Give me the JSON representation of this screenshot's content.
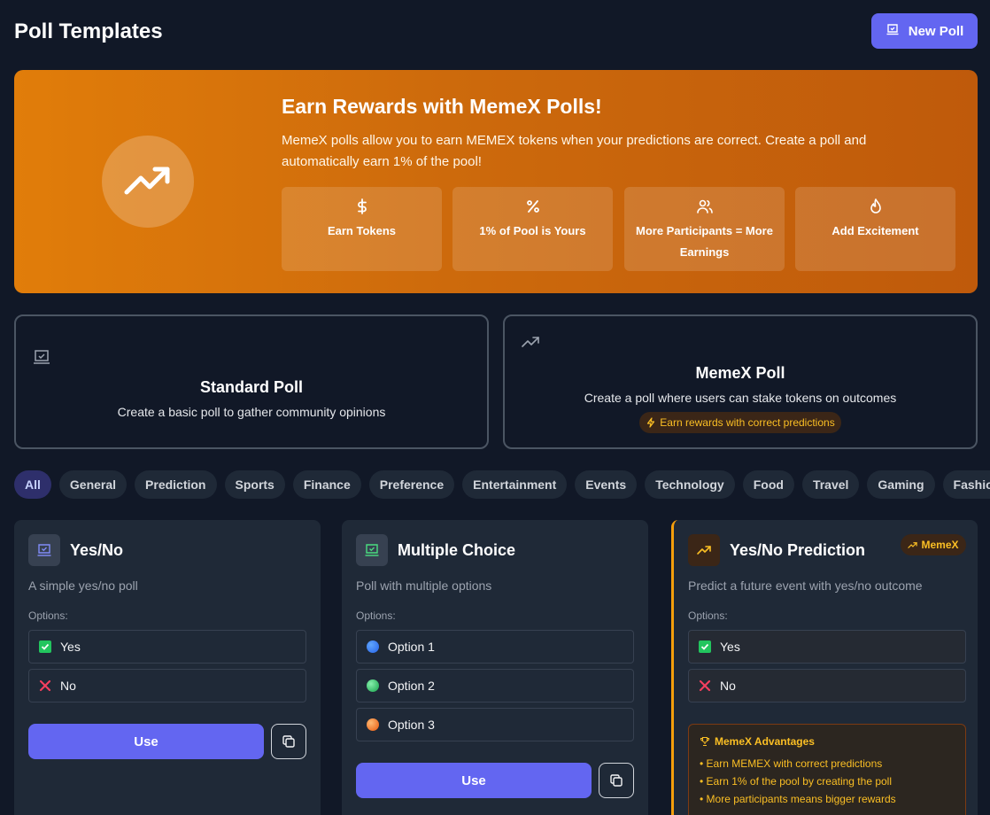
{
  "header": {
    "title": "Poll Templates",
    "new_poll_label": "New Poll"
  },
  "banner": {
    "title": "Earn Rewards with MemeX Polls!",
    "description": "MemeX polls allow you to earn MEMEX tokens when your predictions are correct. Create a poll and automatically earn 1% of the pool!",
    "features": [
      {
        "icon": "dollar-icon",
        "label": "Earn Tokens"
      },
      {
        "icon": "percent-icon",
        "label": "1% of Pool is Yours"
      },
      {
        "icon": "users-icon",
        "label": "More Participants = More Earnings"
      },
      {
        "icon": "flame-icon",
        "label": "Add Excitement"
      }
    ]
  },
  "poll_types": [
    {
      "icon": "poll-icon",
      "title": "Standard Poll",
      "description": "Create a basic poll to gather community opinions"
    },
    {
      "icon": "trending-up-icon",
      "title": "MemeX Poll",
      "description": "Create a poll where users can stake tokens on outcomes",
      "badge": "Earn rewards with correct predictions"
    }
  ],
  "filters": {
    "active": "All",
    "items": [
      "All",
      "General",
      "Prediction",
      "Sports",
      "Finance",
      "Preference",
      "Entertainment",
      "Events",
      "Technology",
      "Food",
      "Travel",
      "Gaming",
      "Fashion"
    ]
  },
  "templates": [
    {
      "title": "Yes/No",
      "description": "A simple yes/no poll",
      "options_label": "Options:",
      "options": [
        "Yes",
        "No"
      ],
      "use_label": "Use"
    },
    {
      "title": "Multiple Choice",
      "description": "Poll with multiple options",
      "options_label": "Options:",
      "options": [
        "Option 1",
        "Option 2",
        "Option 3"
      ],
      "use_label": "Use"
    },
    {
      "title": "Yes/No Prediction",
      "tag": "MemeX",
      "description": "Predict a future event with yes/no outcome",
      "options_label": "Options:",
      "options": [
        "Yes",
        "No"
      ],
      "advantages_title": "MemeX Advantages",
      "advantages": [
        "• Earn MEMEX with correct predictions",
        "• Earn 1% of the pool by creating the poll",
        "• More participants means bigger rewards"
      ]
    }
  ],
  "colors": {
    "accent": "#6366f1",
    "banner_start": "#e17d0a",
    "banner_end": "#bf5a0b",
    "memex_amber": "#fbbf24",
    "option_dots": [
      "#3b82f6",
      "#22c55e",
      "#f97316"
    ]
  }
}
